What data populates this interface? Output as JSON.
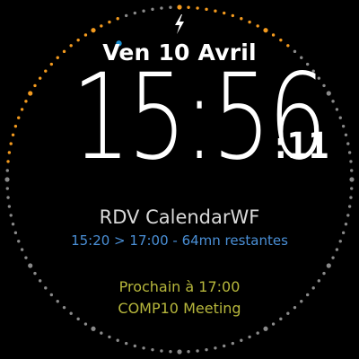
{
  "watchface": {
    "date": "Ven 10 Avril",
    "time": "15:56",
    "seconds": ":11",
    "current_event": {
      "title": "RDV CalendarWF",
      "time_range": "15:20 > 17:00 - 64mn restantes"
    },
    "next_event": {
      "label": "Prochain à 17:00",
      "title": "COMP10 Meeting"
    },
    "status_icon": "charging-bolt-icon"
  },
  "colors": {
    "background": "#000000",
    "dot": "#8a8a8a",
    "elapsed_dot": "#f39a1e",
    "minute_marker": "#1a8fd0",
    "event_time": "#4a8fd6",
    "next_event": "#b7b73c"
  }
}
